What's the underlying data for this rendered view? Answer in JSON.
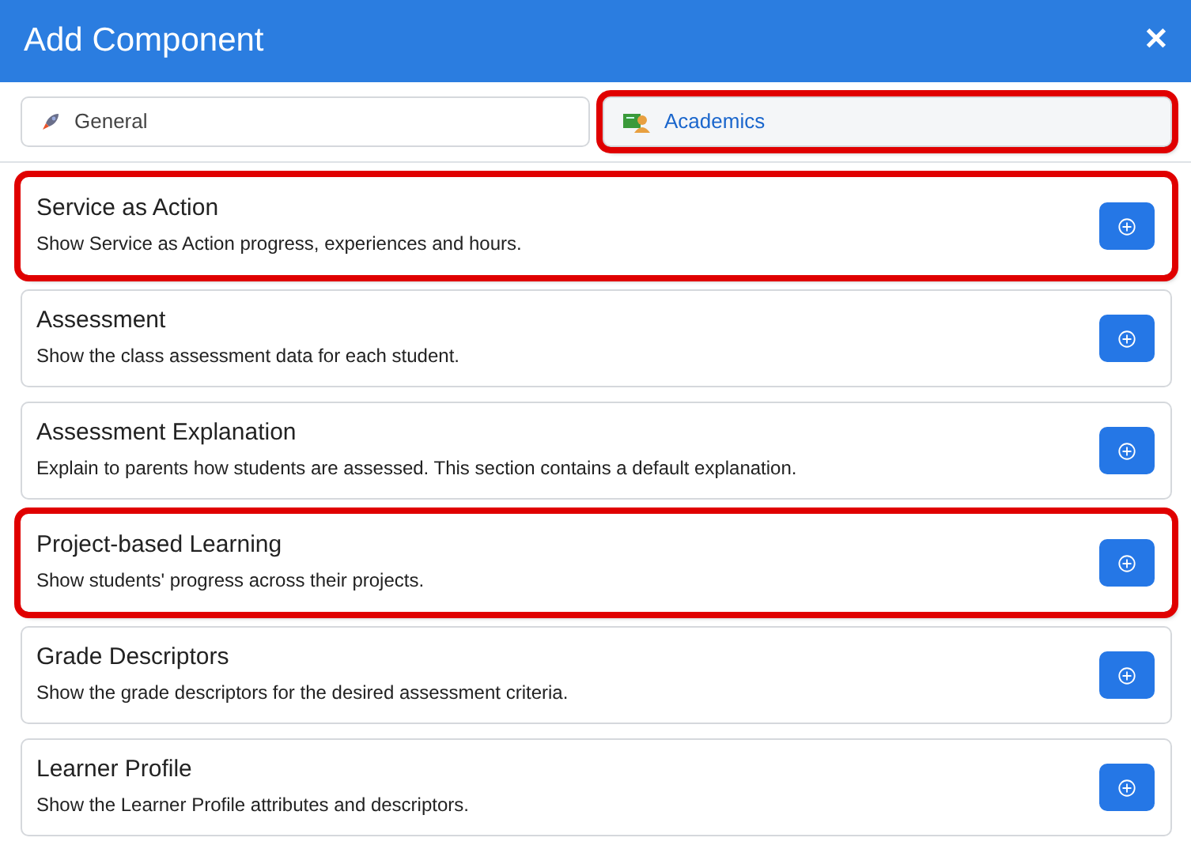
{
  "window": {
    "title": "Add Component",
    "close": "✕"
  },
  "tabs": [
    {
      "label": "General",
      "selected": false,
      "highlighted": false,
      "kind": "rocket"
    },
    {
      "label": "Academics",
      "selected": true,
      "highlighted": true,
      "kind": "teacher"
    }
  ],
  "components": [
    {
      "title": "Service as Action",
      "description": "Show Service as Action progress, experiences and hours.",
      "highlighted": true
    },
    {
      "title": "Assessment",
      "description": "Show the class assessment data for each student.",
      "highlighted": false
    },
    {
      "title": "Assessment Explanation",
      "description": "Explain to parents how students are assessed. This section contains a default explanation.",
      "highlighted": false
    },
    {
      "title": "Project-based Learning",
      "description": "Show students' progress across their projects.",
      "highlighted": true
    },
    {
      "title": "Grade Descriptors",
      "description": "Show the grade descriptors for the desired assessment criteria.",
      "highlighted": false
    },
    {
      "title": "Learner Profile",
      "description": "Show the Learner Profile attributes and descriptors.",
      "highlighted": false
    }
  ]
}
